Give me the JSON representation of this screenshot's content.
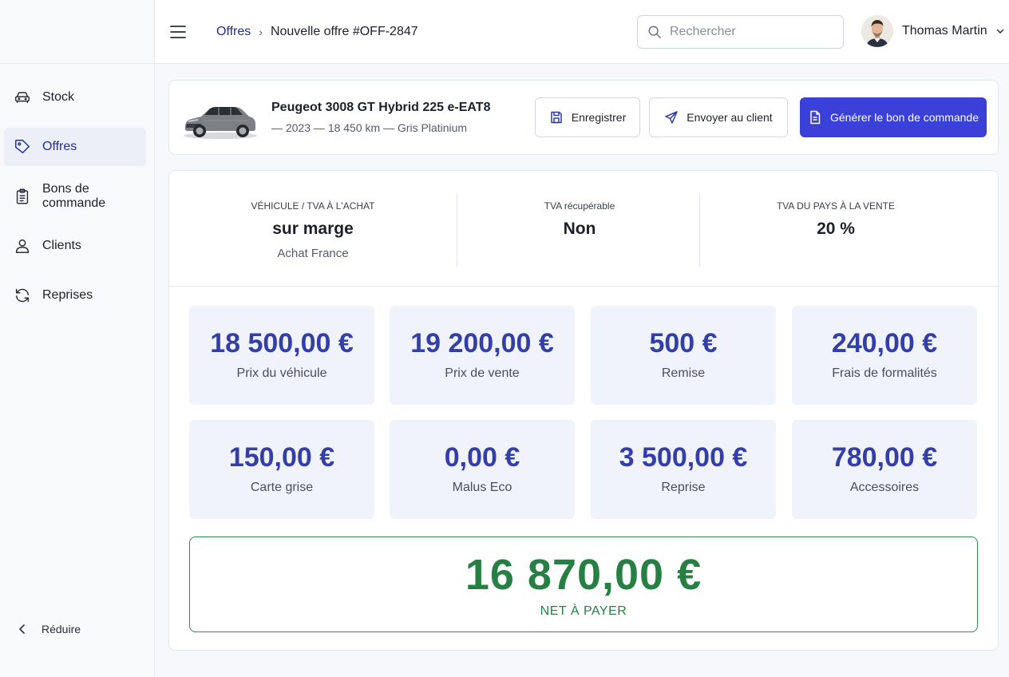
{
  "sidebar": {
    "items": [
      {
        "label": "Stock",
        "icon": "car-icon"
      },
      {
        "label": "Offres",
        "icon": "tag-icon",
        "active": true
      },
      {
        "label": "Bons de commande",
        "icon": "clipboard-icon"
      },
      {
        "label": "Clients",
        "icon": "user-icon"
      },
      {
        "label": "Reprises",
        "icon": "refresh-icon"
      }
    ],
    "collapse_label": "Réduire"
  },
  "header": {
    "breadcrumb_link": "Offres",
    "breadcrumb_current": "Nouvelle offre #OFF-2847",
    "search_placeholder": "Rechercher",
    "user_name": "Thomas Martin"
  },
  "vehicle": {
    "title": "Peugeot 3008 GT Hybrid 225 e-EAT8",
    "meta": "— 2023 — 18 450 km — Gris Platinium",
    "actions": {
      "save": "Enregistrer",
      "send": "Envoyer au client",
      "generate": "Générer le bon de commande"
    }
  },
  "vat": {
    "purchase": {
      "label": "VÉHICULE / TVA À L'ACHAT",
      "value": "sur marge",
      "sub": "Achat France"
    },
    "recoverable": {
      "label": "TVA récupérable",
      "value": "Non"
    },
    "sale_country": {
      "label": "TVA DU PAYS À LA VENTE",
      "value": "20 %"
    }
  },
  "amounts": [
    {
      "value": "18 500,00 €",
      "label": "Prix du véhicule"
    },
    {
      "value": "19 200,00 €",
      "label": "Prix de vente"
    },
    {
      "value": "500 €",
      "label": "Remise"
    },
    {
      "value": "240,00 €",
      "label": "Frais de formalités"
    },
    {
      "value": "150,00 €",
      "label": "Carte grise"
    },
    {
      "value": "0,00 €",
      "label": "Malus Eco"
    },
    {
      "value": "3 500,00 €",
      "label": "Reprise"
    },
    {
      "value": "780,00 €",
      "label": "Accessoires"
    }
  ],
  "net": {
    "value": "16 870,00 €",
    "label": "NET À PAYER"
  },
  "colors": {
    "accent": "#3a40d8",
    "amount": "#333ea8",
    "net": "#268043"
  }
}
